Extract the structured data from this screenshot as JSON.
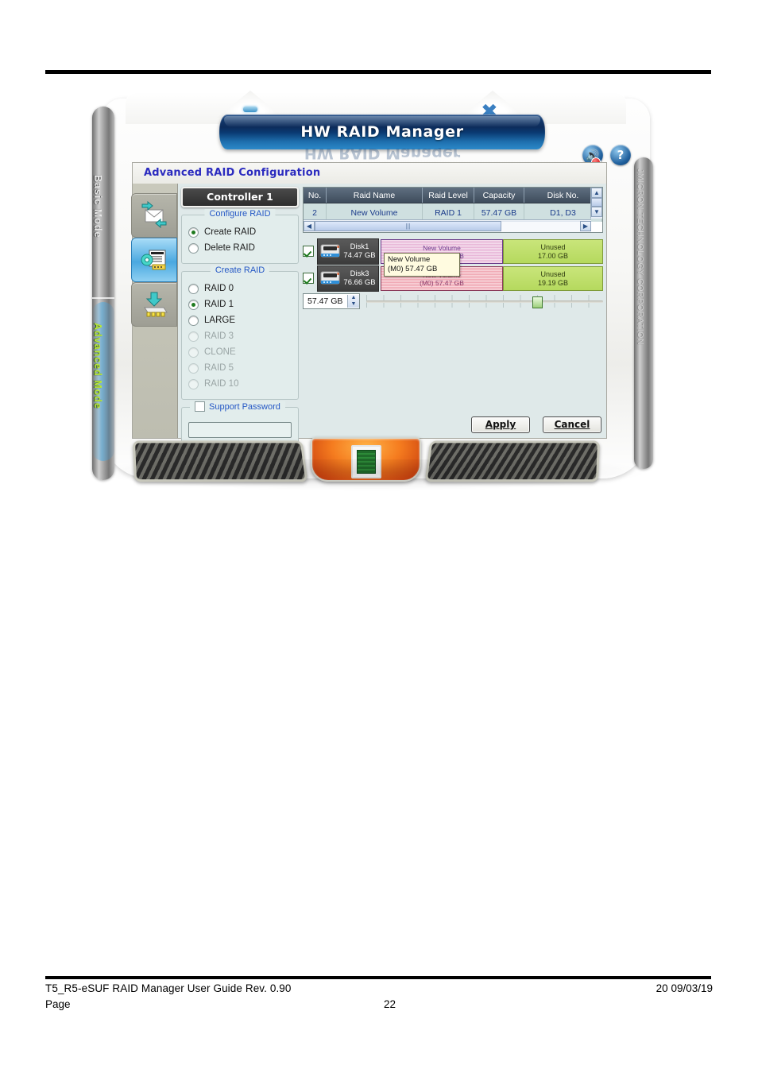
{
  "page": {
    "footer_left": "T5_R5-eSUF RAID Manager User Guide Rev. 0.90",
    "footer_right": "20  09/03/19",
    "footer_page_label": "Page",
    "footer_page_number": "22"
  },
  "device": {
    "banner_title": "HW RAID Manager",
    "brand_vertical": "JMICRON TECHNOLOGY CORPORATION",
    "mode_basic": "Basic Mode",
    "mode_advanced": "Advanced Mode",
    "sound_icon": "speaker-muted-icon",
    "help_icon": "question-mark-icon",
    "logo_icon": "x-logo-icon"
  },
  "app": {
    "title": "Advanced RAID Configuration",
    "side_tabs": [
      {
        "name": "basic-raid-tab",
        "icon": "envelope-transfer-icon",
        "selected": false
      },
      {
        "name": "advanced-raid-tab",
        "icon": "gear-document-icon",
        "selected": true
      },
      {
        "name": "firmware-update-tab",
        "icon": "download-chip-icon",
        "selected": false
      }
    ],
    "controller_button": "Controller 1",
    "configure_raid": {
      "group_title": "Configure RAID",
      "options": [
        {
          "label": "Create RAID",
          "selected": true,
          "enabled": true
        },
        {
          "label": "Delete RAID",
          "selected": false,
          "enabled": true
        }
      ]
    },
    "create_raid": {
      "group_title": "Create RAID",
      "options": [
        {
          "label": "RAID 0",
          "selected": false,
          "enabled": true
        },
        {
          "label": "RAID 1",
          "selected": true,
          "enabled": true
        },
        {
          "label": "LARGE",
          "selected": false,
          "enabled": true
        },
        {
          "label": "RAID 3",
          "selected": false,
          "enabled": false
        },
        {
          "label": "CLONE",
          "selected": false,
          "enabled": false
        },
        {
          "label": "RAID 5",
          "selected": false,
          "enabled": false
        },
        {
          "label": "RAID 10",
          "selected": false,
          "enabled": false
        }
      ]
    },
    "support_password": {
      "label": "Support Password",
      "checked": false,
      "value": ""
    },
    "raid_table": {
      "columns": [
        "No.",
        "Raid Name",
        "Raid Level",
        "Capacity",
        "Disk No."
      ],
      "rows": [
        {
          "no": "2",
          "name": "New Volume",
          "level": "RAID 1",
          "capacity": "57.47 GB",
          "disks": "D1, D3"
        }
      ],
      "scroll_up_icon": "chevron-up-icon",
      "scroll_down_icon": "chevron-down-icon",
      "scroll_left_icon": "chevron-left-icon",
      "scroll_right_icon": "chevron-right-icon"
    },
    "disks": [
      {
        "checked": true,
        "name": "Disk1",
        "capacity": "74.47 GB",
        "icon": "hard-disk-icon",
        "used_label_line1": "New Volume",
        "used_label_line2": "(M0) 57.47 GB",
        "unused_label": "Unused",
        "unused_capacity": "17.00 GB"
      },
      {
        "checked": true,
        "name": "Disk3",
        "capacity": "76.66 GB",
        "icon": "hard-disk-icon",
        "used_label_line1": "New Volume",
        "used_label_line2": "(M0) 57.47 GB",
        "unused_label": "Unused",
        "unused_capacity": "19.19 GB"
      }
    ],
    "tooltip": {
      "line1": "New Volume",
      "line2": "(M0) 57.47 GB"
    },
    "capacity_spinner": {
      "value": "57.47 GB",
      "up_icon": "spinner-up-icon",
      "down_icon": "spinner-down-icon"
    },
    "capacity_slider": {
      "position_percent": 70
    },
    "buttons": {
      "apply": "Apply",
      "cancel": "Cancel"
    }
  },
  "colors": {
    "accent_blue": "#2b2bbf",
    "banner_blue": "#0d2c5b",
    "selected_tab": "#4aa8e0",
    "unused_green": "#b5d95e",
    "used_pink": "#f0a8b4",
    "advanced_mode_text": "#b9e83a"
  }
}
